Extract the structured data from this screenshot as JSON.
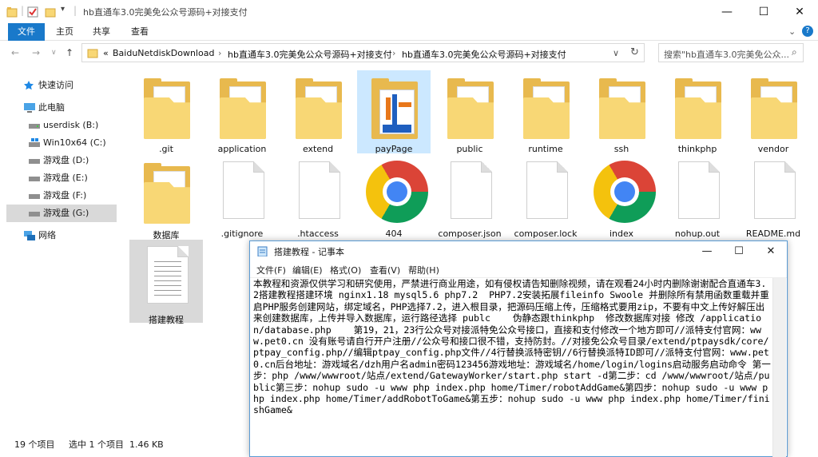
{
  "window": {
    "title": "hb直通车3.0完美免公众号源码+对接支付"
  },
  "ribbon": {
    "tabs": [
      "文件",
      "主页",
      "共享",
      "查看"
    ]
  },
  "address": {
    "prefix": "«",
    "crumbs": [
      "BaiduNetdiskDownload",
      "hb直通车3.0完美免公众号源码+对接支付",
      "hb直通车3.0完美免公众号源码+对接支付"
    ]
  },
  "search": {
    "placeholder": "搜索\"hb直通车3.0完美免公众..."
  },
  "sidebar": {
    "items": [
      {
        "label": "快速访问",
        "icon": "star-icon"
      },
      {
        "label": "此电脑",
        "icon": "computer-icon"
      },
      {
        "label": "userdisk (B:)",
        "icon": "drive-icon"
      },
      {
        "label": "Win10x64 (C:)",
        "icon": "windows-drive-icon"
      },
      {
        "label": "游戏盘 (D:)",
        "icon": "drive-icon"
      },
      {
        "label": "游戏盘 (E:)",
        "icon": "drive-icon"
      },
      {
        "label": "游戏盘 (F:)",
        "icon": "drive-icon"
      },
      {
        "label": "游戏盘 (G:)",
        "icon": "drive-icon"
      },
      {
        "label": "网络",
        "icon": "network-icon"
      }
    ]
  },
  "files": [
    {
      "name": ".git",
      "type": "folder"
    },
    {
      "name": "application",
      "type": "folder"
    },
    {
      "name": "extend",
      "type": "folder"
    },
    {
      "name": "payPage",
      "type": "folder-image"
    },
    {
      "name": "public",
      "type": "folder"
    },
    {
      "name": "runtime",
      "type": "folder"
    },
    {
      "name": "ssh",
      "type": "folder"
    },
    {
      "name": "thinkphp",
      "type": "folder"
    },
    {
      "name": "vendor",
      "type": "folder"
    },
    {
      "name": "数据库",
      "type": "folder"
    },
    {
      "name": ".gitignore",
      "type": "file"
    },
    {
      "name": ".htaccess",
      "type": "file"
    },
    {
      "name": "404",
      "type": "chrome"
    },
    {
      "name": "composer.json",
      "type": "file"
    },
    {
      "name": "composer.lock",
      "type": "file"
    },
    {
      "name": "index",
      "type": "chrome"
    },
    {
      "name": "nohup.out",
      "type": "file"
    },
    {
      "name": "README.md",
      "type": "file"
    },
    {
      "name": "搭建教程",
      "type": "text-file"
    }
  ],
  "status": {
    "count": "19 个项目",
    "selection": "选中 1 个项目  1.46 KB"
  },
  "notepad": {
    "title": "搭建教程 - 记事本",
    "menu": [
      "文件(F)",
      "编辑(E)",
      "格式(O)",
      "查看(V)",
      "帮助(H)"
    ],
    "text": "本教程和资源仅供学习和研究使用，严禁进行商业用途，如有侵权请告知删除视频，请在观看24小时内删除谢谢配合直通车3.2搭建教程搭建环境 nginx1.18 mysql5.6 php7.2  PHP7.2安装拓展fileinfo Swoole 并删除所有禁用函数重载并重启PHP服务创建网站，绑定域名，PHP选择7.2，进入根目录，把源码压缩上传，压缩格式要用zip，不要有中文上传好解压出来创建数据库，上传并导入数据库，运行路径选择 publc    伪静态跟thinkphp  修改数据库对接 修改 /application/database.php    第19，21，23行公众号对接派特免公众号接口，直接和支付修改一个地方即可//派特支付官网：www.pet0.cn 没有账号请自行开户注册//公众号和接口很不错，支持防封。//对接免公众号目录/extend/ptpaysdk/core/ptpay_config.php//编辑ptpay_config.php文件//4行替换派特密钥//6行替换派特ID即可//派特支付官网：www.pet0.cn后台地址：游戏域名/dzh用户名admin密码123456游戏地址：游戏域名/home/login/logins启动服务启动命令 第一步：php /www/wwwroot/站点/extend/GatewayWorker/start.php start -d第二步：cd /www/wwwroot/站点/public第三步：nohup sudo -u www php index.php home/Timer/robotAddGame&第四步：nohup sudo -u www php index.php home/Timer/addRobotToGame&第五步：nohup sudo -u www php index.php home/Timer/finishGame&"
  }
}
